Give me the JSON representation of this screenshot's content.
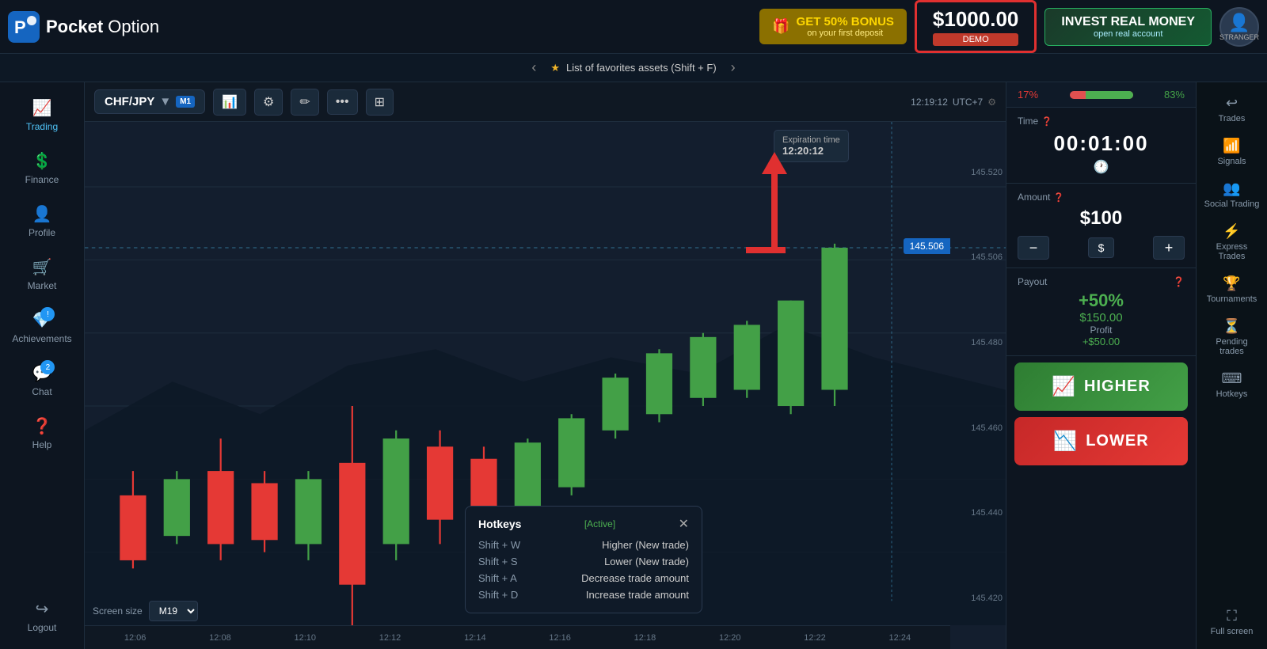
{
  "header": {
    "logo_text_bold": "Pocket",
    "logo_text_light": " Option",
    "bonus_title": "GET 50% BONUS",
    "bonus_sub": "on your first deposit",
    "demo_amount": "$1000.00",
    "demo_label": "DEMO",
    "invest_title": "INVEST REAL MONEY",
    "invest_sub": "open real account",
    "user_label": "STRANGER"
  },
  "favorites_bar": {
    "text": "List of favorites assets (Shift + F)"
  },
  "sidebar": {
    "items": [
      {
        "label": "Trading",
        "icon": "📈"
      },
      {
        "label": "Finance",
        "icon": "💲"
      },
      {
        "label": "Profile",
        "icon": "👤"
      },
      {
        "label": "Market",
        "icon": "🛒"
      },
      {
        "label": "Achievements",
        "icon": "💎"
      },
      {
        "label": "Chat",
        "icon": "💬"
      },
      {
        "label": "Help",
        "icon": "❓"
      }
    ],
    "logout_label": "Logout",
    "badge_chat": "2"
  },
  "chart": {
    "asset": "CHF/JPY",
    "timeframe": "M1",
    "time_display": "12:19:12",
    "timezone": "UTC+7",
    "expiration_label": "Expiration time",
    "expiration_time": "12:20:12",
    "current_price": "145.506",
    "price_badge": "145.506",
    "x_labels": [
      "12:06",
      "12:08",
      "12:10",
      "12:12",
      "12:14",
      "12:16",
      "12:18",
      "12:20",
      "12:22",
      "12:24"
    ],
    "y_labels": [
      "145.520",
      "145.506",
      "145.480",
      "145.460",
      "145.440",
      "145.420"
    ],
    "screen_size_label": "Screen size",
    "screen_size_value": "M19"
  },
  "right_panel": {
    "pct_left": "17%",
    "pct_right": "83%",
    "time_label": "Time",
    "time_value": "00:01:00",
    "amount_label": "Amount",
    "amount_value": "$100",
    "payout_label": "Payout",
    "payout_pct": "+50%",
    "profit_amount": "$150.00",
    "profit_label": "Profit",
    "profit_plus": "+$50.00",
    "higher_label": "HIGHER",
    "lower_label": "LOWER"
  },
  "far_right": {
    "items": [
      {
        "label": "Trades",
        "icon": "↩"
      },
      {
        "label": "Signals",
        "icon": "📶"
      },
      {
        "label": "Social Trading",
        "icon": "👥"
      },
      {
        "label": "Express Trades",
        "icon": "⚡"
      },
      {
        "label": "Tournaments",
        "icon": "🏆"
      },
      {
        "label": "Pending trades",
        "icon": "⏳"
      },
      {
        "label": "Hotkeys",
        "icon": "⌨"
      },
      {
        "label": "Full screen",
        "icon": "⛶"
      }
    ]
  },
  "hotkeys": {
    "title": "Hotkeys",
    "status": "[Active]",
    "rows": [
      {
        "key": "Shift + W",
        "action": "Higher (New trade)"
      },
      {
        "key": "Shift + S",
        "action": "Lower (New trade)"
      },
      {
        "key": "Shift + A",
        "action": "Decrease trade amount"
      },
      {
        "key": "Shift + D",
        "action": "Increase trade amount"
      }
    ]
  }
}
